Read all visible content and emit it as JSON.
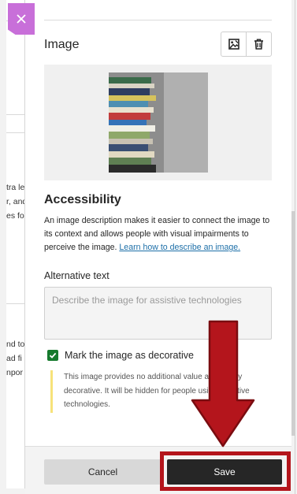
{
  "background": {
    "fragments": [
      "tra le",
      "r, and",
      "es fo",
      "nd to",
      "ad fi",
      "npor"
    ]
  },
  "panel": {
    "section_title": "Image",
    "icons": {
      "replace": "image-replace-icon",
      "delete": "trash-icon",
      "close": "close-icon",
      "check": "checkmark-icon"
    },
    "accessibility": {
      "heading": "Accessibility",
      "description": "An image description makes it easier to connect the image to its context and allows people with visual impairments to perceive the image.",
      "link": "Learn how to describe an image."
    },
    "alt_text": {
      "label": "Alternative text",
      "placeholder": "Describe the image for assistive technologies",
      "value": ""
    },
    "decorative": {
      "label": "Mark the image as decorative",
      "checked": true,
      "note": "This image provides no additional value and is only decorative. It will be hidden for people using assistive technologies."
    }
  },
  "footer": {
    "cancel_label": "Cancel",
    "save_label": "Save"
  },
  "colors": {
    "close_button": "#c86fd9",
    "checkbox": "#167a2d",
    "save_button": "#262626",
    "annotation": "#b4151c",
    "note_bar": "#f7e27a",
    "link": "#1d6fa8"
  }
}
